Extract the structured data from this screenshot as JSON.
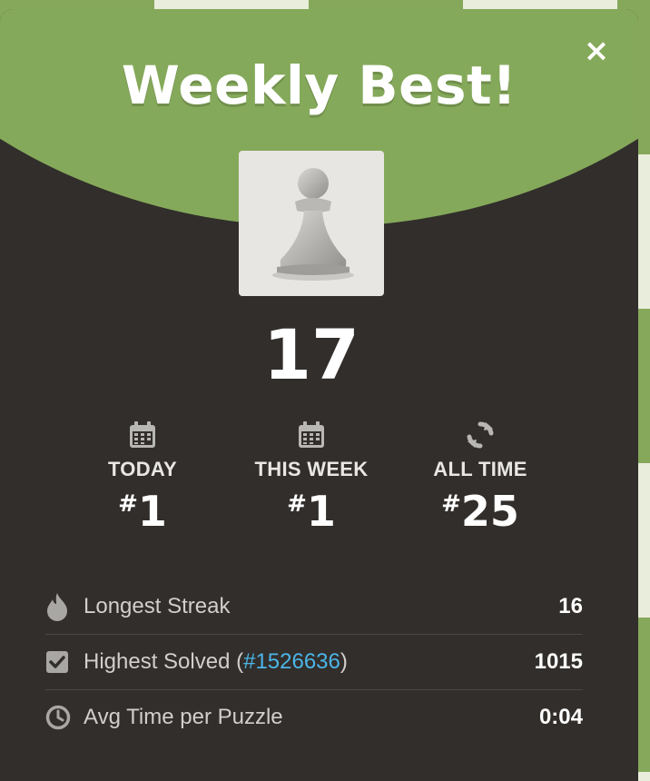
{
  "modal": {
    "title": "Weekly Best!",
    "close_label": "×",
    "score": "17"
  },
  "stats": [
    {
      "label": "TODAY",
      "hash": "#",
      "rank": "1",
      "icon": "calendar-icon"
    },
    {
      "label": "THIS WEEK",
      "hash": "#",
      "rank": "1",
      "icon": "calendar-icon"
    },
    {
      "label": "ALL TIME",
      "hash": "#",
      "rank": "25",
      "icon": "refresh-icon"
    }
  ],
  "rows": {
    "streak": {
      "label": "Longest Streak",
      "value": "16",
      "icon": "flame-icon"
    },
    "solved": {
      "label_pre": "Highest Solved (",
      "link": "#1526636",
      "label_post": ")",
      "value": "1015",
      "icon": "checkbox-icon"
    },
    "avg": {
      "label": "Avg Time per Puzzle",
      "value": "0:04",
      "icon": "clock-icon"
    }
  },
  "colors": {
    "accent_green": "#85a95a",
    "modal_bg": "#312e2b",
    "link": "#4cb5e7"
  }
}
